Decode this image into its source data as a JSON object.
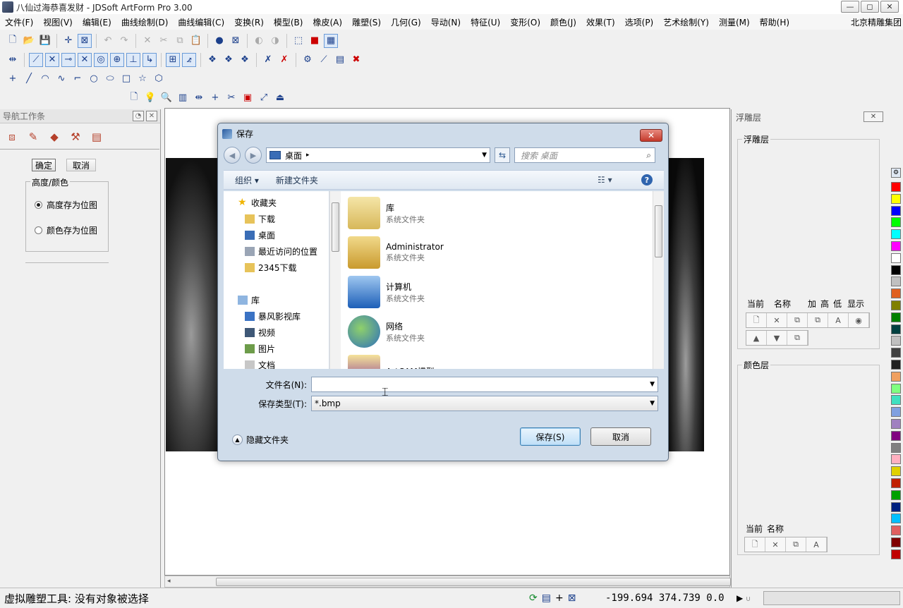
{
  "app": {
    "title": "八仙过海恭喜发财 - JDSoft ArtForm Pro 3.00",
    "window_buttons": [
      "—",
      "◻",
      "✕"
    ]
  },
  "menu": {
    "items": [
      "文件(F)",
      "视图(V)",
      "编辑(E)",
      "曲线绘制(D)",
      "曲线编辑(C)",
      "变换(R)",
      "模型(B)",
      "橡皮(A)",
      "雕塑(S)",
      "几何(G)",
      "导动(N)",
      "特征(U)",
      "变形(O)",
      "颜色(J)",
      "效果(T)",
      "选项(P)",
      "艺术绘制(Y)",
      "测量(M)",
      "帮助(H)"
    ],
    "company": "北京精雕集团"
  },
  "nav_panel": {
    "title": "导航工作条",
    "confirm": "确定",
    "cancel": "取消",
    "group_label": "高度/颜色",
    "options": [
      {
        "label": "高度存为位图",
        "checked": true
      },
      {
        "label": "颜色存为位图",
        "checked": false
      }
    ]
  },
  "relief_panel": {
    "title": "浮雕层",
    "group1_label": "浮雕层",
    "group1_headers": [
      "当前",
      "名称",
      "加",
      "高",
      "低",
      "显示"
    ],
    "group2_label": "颜色层",
    "group2_headers": [
      "当前",
      "名称"
    ]
  },
  "palette": [
    "#ff0000",
    "#ffff00",
    "#0000ff",
    "#00ff00",
    "#00ffff",
    "#ff00ff",
    "#ffffff",
    "#000000",
    "#c0c0c0",
    "#e06020",
    "#808000",
    "#008000",
    "#004040",
    "#c0c0c0",
    "#404040",
    "#202020",
    "#f0a060",
    "#80ff80",
    "#40e0c0",
    "#80a0e0",
    "#a080c0",
    "#800080",
    "#808080",
    "#ffb0c0",
    "#e0d000",
    "#c02000",
    "#00a000",
    "#002080",
    "#00c0ff",
    "#e06060",
    "#800000",
    "#c00000"
  ],
  "status": {
    "text": "虚拟雕塑工具: 没有对象被选择",
    "coords": "-199.694 374.739 0.0"
  },
  "dialog": {
    "title": "保存",
    "close": "✕",
    "address": "桌面",
    "search_placeholder": "搜索 桌面",
    "organize": "组织 ▾",
    "new_folder": "新建文件夹",
    "tree": [
      {
        "label": "收藏夹",
        "icon": "star-icon",
        "indent": 0
      },
      {
        "label": "下载",
        "icon": "download-folder-icon",
        "indent": 1
      },
      {
        "label": "桌面",
        "icon": "desktop-icon",
        "indent": 1
      },
      {
        "label": "最近访问的位置",
        "icon": "recent-places-icon",
        "indent": 1
      },
      {
        "label": "2345下载",
        "icon": "folder-icon",
        "indent": 1
      },
      {
        "label": "库",
        "icon": "library-icon",
        "indent": 0
      },
      {
        "label": "暴风影视库",
        "icon": "video-library-icon",
        "indent": 1
      },
      {
        "label": "视频",
        "icon": "video-icon",
        "indent": 1
      },
      {
        "label": "图片",
        "icon": "picture-icon",
        "indent": 1
      },
      {
        "label": "文档",
        "icon": "document-icon",
        "indent": 1
      }
    ],
    "files": [
      {
        "name": "库",
        "type": "系统文件夹",
        "icon": "library-folder-icon"
      },
      {
        "name": "Administrator",
        "type": "系统文件夹",
        "icon": "user-folder-icon"
      },
      {
        "name": "计算机",
        "type": "系统文件夹",
        "icon": "computer-icon"
      },
      {
        "name": "网络",
        "type": "系统文件夹",
        "icon": "network-icon"
      },
      {
        "name": "ArtCAM模型",
        "type": "",
        "icon": "artcam-icon"
      }
    ],
    "filename_label": "文件名(N):",
    "filename_value": "",
    "filetype_label": "保存类型(T):",
    "filetype_value": "*.bmp",
    "hide_folders": "隐藏文件夹",
    "save": "保存(S)",
    "cancel": "取消"
  }
}
